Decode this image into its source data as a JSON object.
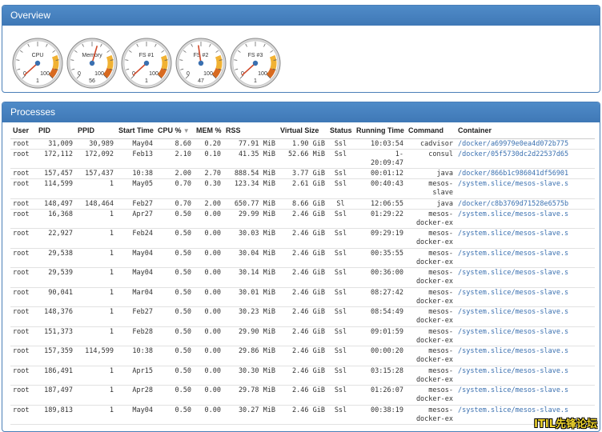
{
  "overview": {
    "title": "Overview",
    "gauges": [
      {
        "label": "CPU",
        "min": "0",
        "max": "100",
        "value": "1",
        "level": 1
      },
      {
        "label": "Memory",
        "min": "0",
        "max": "100",
        "value": "56",
        "level": 56
      },
      {
        "label": "FS #1",
        "min": "0",
        "max": "100",
        "value": "1",
        "level": 1
      },
      {
        "label": "FS #2",
        "min": "0",
        "max": "100",
        "value": "47",
        "level": 47
      },
      {
        "label": "FS #3",
        "min": "0",
        "max": "100",
        "value": "1",
        "level": 1
      }
    ]
  },
  "processes": {
    "title": "Processes",
    "headers": [
      "User",
      "PID",
      "PPID",
      "Start Time",
      "CPU %",
      "MEM %",
      "RSS",
      "Virtual Size",
      "Status",
      "Running Time",
      "Command",
      "Container"
    ],
    "sort_indicator": "▼",
    "rows": [
      [
        "root",
        "31,009",
        "30,989",
        "May04",
        "8.60",
        "0.20",
        "77.91 MiB",
        "1.90 GiB",
        "Ssl",
        "10:03:54",
        "cadvisor",
        "/docker/a69979e0ea4d072b775"
      ],
      [
        "root",
        "172,112",
        "172,092",
        "Feb13",
        "2.10",
        "0.10",
        "41.35 MiB",
        "52.66 MiB",
        "Ssl",
        "1-\n20:09:47",
        "consul",
        "/docker/05f5730dc2d22537d65"
      ],
      [
        "root",
        "157,457",
        "157,437",
        "10:38",
        "2.00",
        "2.70",
        "888.54 MiB",
        "3.77 GiB",
        "Ssl",
        "00:01:12",
        "java",
        "/docker/866b1c986041df56901"
      ],
      [
        "root",
        "114,599",
        "1",
        "May05",
        "0.70",
        "0.30",
        "123.34 MiB",
        "2.61 GiB",
        "Ssl",
        "00:40:43",
        "mesos-\nslave",
        "/system.slice/mesos-slave.s"
      ],
      [
        "root",
        "148,497",
        "148,464",
        "Feb27",
        "0.70",
        "2.00",
        "650.77 MiB",
        "8.66 GiB",
        "Sl",
        "12:06:55",
        "java",
        "/docker/c8b3769d71528e6575b"
      ],
      [
        "root",
        "16,368",
        "1",
        "Apr27",
        "0.50",
        "0.00",
        "29.99 MiB",
        "2.46 GiB",
        "Ssl",
        "01:29:22",
        "mesos-\ndocker-ex",
        "/system.slice/mesos-slave.s"
      ],
      [
        "root",
        "22,927",
        "1",
        "Feb24",
        "0.50",
        "0.00",
        "30.03 MiB",
        "2.46 GiB",
        "Ssl",
        "09:29:19",
        "mesos-\ndocker-ex",
        "/system.slice/mesos-slave.s"
      ],
      [
        "root",
        "29,538",
        "1",
        "May04",
        "0.50",
        "0.00",
        "30.04 MiB",
        "2.46 GiB",
        "Ssl",
        "00:35:55",
        "mesos-\ndocker-ex",
        "/system.slice/mesos-slave.s"
      ],
      [
        "root",
        "29,539",
        "1",
        "May04",
        "0.50",
        "0.00",
        "30.14 MiB",
        "2.46 GiB",
        "Ssl",
        "00:36:00",
        "mesos-\ndocker-ex",
        "/system.slice/mesos-slave.s"
      ],
      [
        "root",
        "90,041",
        "1",
        "Mar04",
        "0.50",
        "0.00",
        "30.01 MiB",
        "2.46 GiB",
        "Ssl",
        "08:27:42",
        "mesos-\ndocker-ex",
        "/system.slice/mesos-slave.s"
      ],
      [
        "root",
        "148,376",
        "1",
        "Feb27",
        "0.50",
        "0.00",
        "30.23 MiB",
        "2.46 GiB",
        "Ssl",
        "08:54:49",
        "mesos-\ndocker-ex",
        "/system.slice/mesos-slave.s"
      ],
      [
        "root",
        "151,373",
        "1",
        "Feb28",
        "0.50",
        "0.00",
        "29.90 MiB",
        "2.46 GiB",
        "Ssl",
        "09:01:59",
        "mesos-\ndocker-ex",
        "/system.slice/mesos-slave.s"
      ],
      [
        "root",
        "157,359",
        "114,599",
        "10:38",
        "0.50",
        "0.00",
        "29.86 MiB",
        "2.46 GiB",
        "Ssl",
        "00:00:20",
        "mesos-\ndocker-ex",
        "/system.slice/mesos-slave.s"
      ],
      [
        "root",
        "186,491",
        "1",
        "Apr15",
        "0.50",
        "0.00",
        "30.30 MiB",
        "2.46 GiB",
        "Ssl",
        "03:15:28",
        "mesos-\ndocker-ex",
        "/system.slice/mesos-slave.s"
      ],
      [
        "root",
        "187,497",
        "1",
        "Apr28",
        "0.50",
        "0.00",
        "29.78 MiB",
        "2.46 GiB",
        "Ssl",
        "01:26:07",
        "mesos-\ndocker-ex",
        "/system.slice/mesos-slave.s"
      ],
      [
        "root",
        "189,813",
        "1",
        "May04",
        "0.50",
        "0.00",
        "30.27 MiB",
        "2.46 GiB",
        "Ssl",
        "00:38:19",
        "mesos-\ndocker-ex",
        "/system.slice/mesos-slave.s"
      ]
    ]
  },
  "watermark": "ITIL先锋论坛",
  "colors": {
    "panel_header": "#4a84c2",
    "link": "#3a70b0",
    "gauge_warn": "#f1b233",
    "gauge_danger": "#d86a20",
    "gauge_needle": "#3a70b0"
  }
}
